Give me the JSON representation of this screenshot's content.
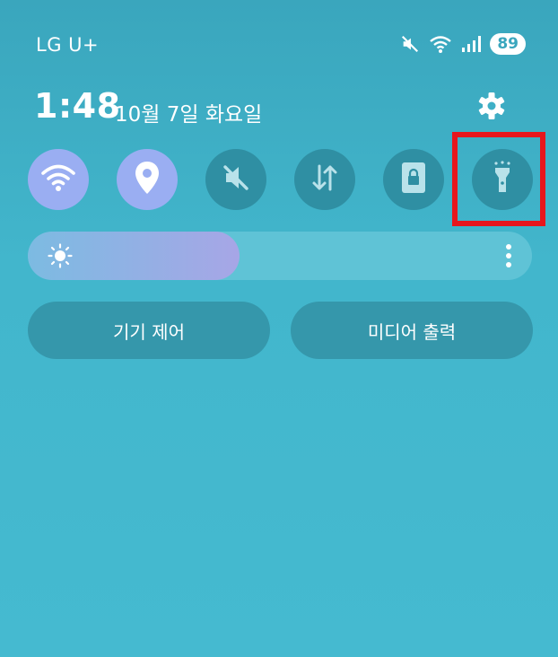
{
  "status_bar": {
    "carrier": "LG U+",
    "battery": "89",
    "icons": [
      "mute-icon",
      "wifi-icon",
      "signal-icon"
    ]
  },
  "panel": {
    "time": "1:48",
    "date": "10월 7일 화요일"
  },
  "quick_tiles": [
    {
      "name": "wifi",
      "icon": "wifi-icon",
      "state": "on"
    },
    {
      "name": "location",
      "icon": "location-pin-icon",
      "state": "on"
    },
    {
      "name": "sound",
      "icon": "mute-icon",
      "state": "off"
    },
    {
      "name": "mobile-data",
      "icon": "data-arrows-icon",
      "state": "off"
    },
    {
      "name": "rotation-lock",
      "icon": "portrait-lock-icon",
      "state": "off"
    },
    {
      "name": "flashlight",
      "icon": "flashlight-icon",
      "state": "off",
      "highlighted": true
    }
  ],
  "brightness": {
    "level_percent": 42
  },
  "buttons": {
    "device_control": "기기 제어",
    "media_output": "미디어 출력"
  },
  "colors": {
    "background": "#42b6cc",
    "tile_on": "#9aaef2",
    "tile_off": "#2f8fa3",
    "highlight": "#e8161c"
  }
}
